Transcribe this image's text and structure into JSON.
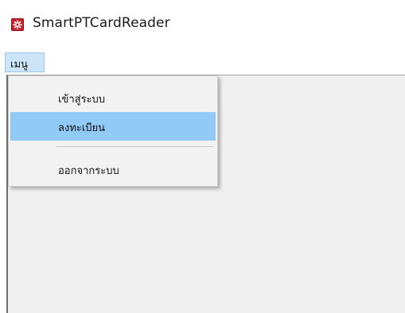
{
  "window": {
    "title": "SmartPTCardReader",
    "icon": "app-logo-icon"
  },
  "menubar": {
    "items": [
      {
        "label": "เมนู"
      }
    ]
  },
  "dropdown": {
    "items": [
      {
        "label": "เข้าสู่ระบบ",
        "highlighted": false
      },
      {
        "label": "ลงทะเบียน",
        "highlighted": true
      },
      {
        "label": "ออกจากระบบ",
        "highlighted": false
      }
    ]
  },
  "colors": {
    "menubar_active_bg": "#cce4f7",
    "highlight_bg": "#91c9f7",
    "client_bg": "#f0f0f0",
    "icon_red": "#c8202a"
  }
}
